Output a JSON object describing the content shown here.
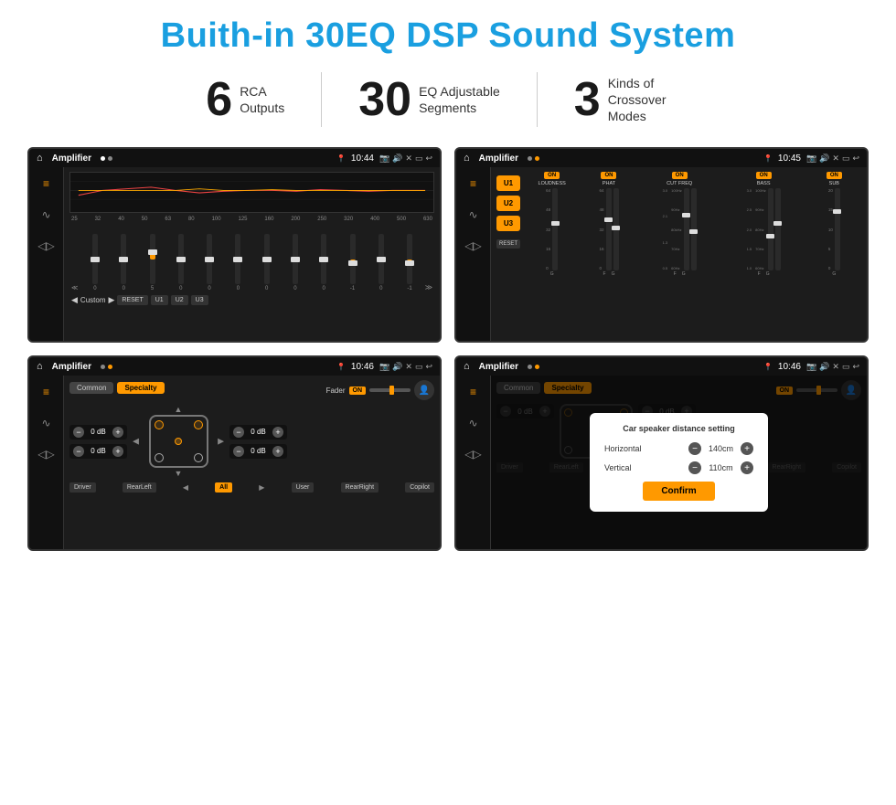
{
  "header": {
    "title": "Buith-in 30EQ DSP Sound System"
  },
  "stats": [
    {
      "number": "6",
      "label": "RCA\nOutputs"
    },
    {
      "number": "30",
      "label": "EQ Adjustable\nSegments"
    },
    {
      "number": "3",
      "label": "Kinds of\nCrossover Modes"
    }
  ],
  "screens": [
    {
      "id": "eq-screen",
      "statusBar": {
        "appTitle": "Amplifier",
        "time": "10:44"
      }
    },
    {
      "id": "crossover-screen",
      "statusBar": {
        "appTitle": "Amplifier",
        "time": "10:45"
      }
    },
    {
      "id": "fader-screen",
      "statusBar": {
        "appTitle": "Amplifier",
        "time": "10:46"
      }
    },
    {
      "id": "distance-screen",
      "statusBar": {
        "appTitle": "Amplifier",
        "time": "10:46"
      }
    }
  ],
  "eqScreen": {
    "freqLabels": [
      "25",
      "32",
      "40",
      "50",
      "63",
      "80",
      "100",
      "125",
      "160",
      "200",
      "250",
      "320",
      "400",
      "500",
      "630"
    ],
    "sliderVals": [
      "0",
      "0",
      "0",
      "5",
      "0",
      "0",
      "0",
      "0",
      "0",
      "0",
      "-1",
      "0",
      "-1"
    ],
    "buttons": [
      "Custom",
      "RESET",
      "U1",
      "U2",
      "U3"
    ]
  },
  "crossover": {
    "presets": [
      "U1",
      "U2",
      "U3"
    ],
    "channels": [
      {
        "name": "LOUDNESS",
        "on": true
      },
      {
        "name": "PHAT",
        "on": true
      },
      {
        "name": "CUT FREQ",
        "on": true
      },
      {
        "name": "BASS",
        "on": true
      },
      {
        "name": "SUB",
        "on": true
      }
    ],
    "resetLabel": "RESET"
  },
  "faderScreen": {
    "tabs": [
      "Common",
      "Specialty"
    ],
    "activeTab": "Specialty",
    "faderLabel": "Fader",
    "faderOnLabel": "ON",
    "dbValues": [
      "0 dB",
      "0 dB",
      "0 dB",
      "0 dB"
    ],
    "bottomBtns": [
      "Driver",
      "RearLeft",
      "All",
      "User",
      "RearRight",
      "Copilot"
    ]
  },
  "distanceScreen": {
    "tabs": [
      "Common",
      "Specialty"
    ],
    "activeTab": "Specialty",
    "modal": {
      "title": "Car speaker distance setting",
      "horizontal": {
        "label": "Horizontal",
        "value": "140cm"
      },
      "vertical": {
        "label": "Vertical",
        "value": "110cm"
      },
      "confirmLabel": "Confirm"
    },
    "dbValues": [
      "0 dB",
      "0 dB"
    ],
    "bottomBtns": [
      "Driver",
      "RearLeft",
      "All",
      "User",
      "RearRight",
      "Copilot"
    ]
  }
}
